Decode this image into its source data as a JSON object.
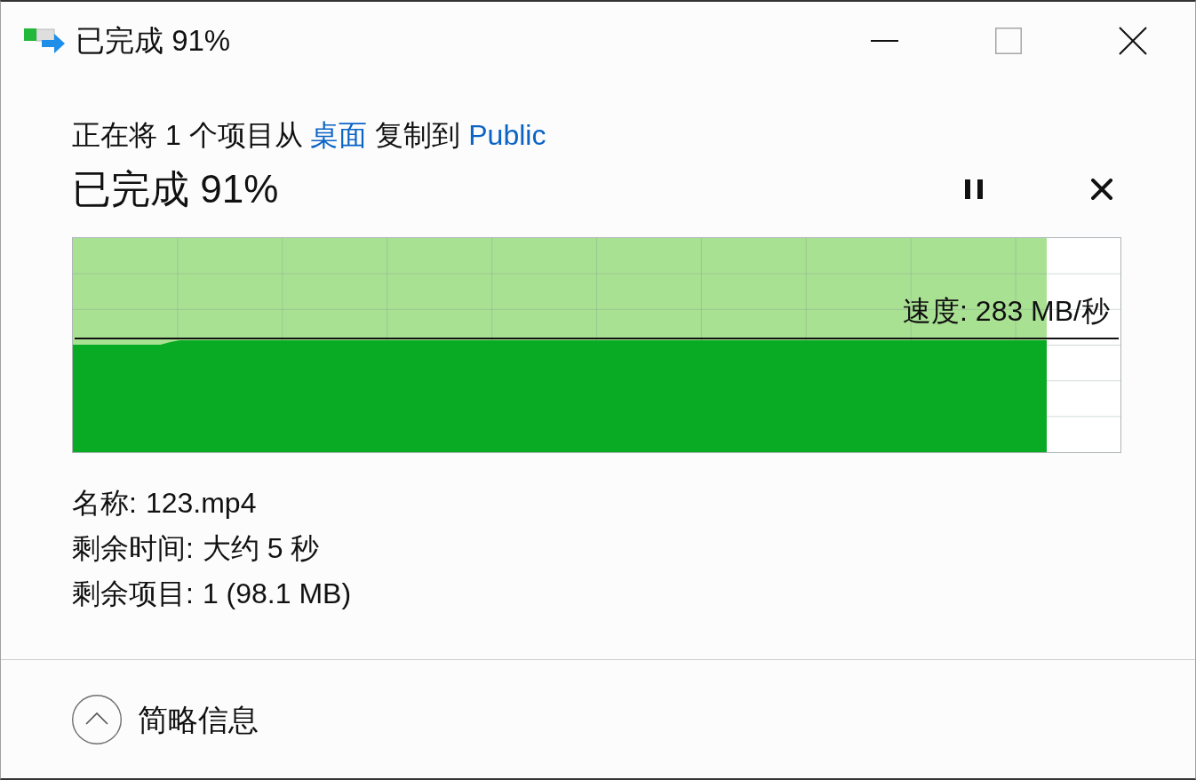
{
  "window": {
    "title": "已完成 91%",
    "controls": [
      {
        "kind": "minimize",
        "disabled": false
      },
      {
        "kind": "maximize",
        "disabled": true
      },
      {
        "kind": "close",
        "disabled": false
      }
    ]
  },
  "description": [
    {
      "kind": "text",
      "text": "正在将 1 个项目从 "
    },
    {
      "kind": "link",
      "text": "桌面"
    },
    {
      "kind": "text",
      "text": " 复制到 "
    },
    {
      "kind": "link",
      "text": "Public"
    }
  ],
  "progress": {
    "heading": "已完成 91%",
    "level": 0.93,
    "speed": "速度: 283 MB/秒"
  },
  "details": {
    "expanded": true,
    "rows": [
      {
        "label": "名称:",
        "value": "123.mp4"
      },
      {
        "label": "剩余时间:",
        "value": "大约 5 秒"
      },
      {
        "label": "剩余项目:",
        "value": "1 (98.1 MB)"
      }
    ],
    "toggle_label": "简略信息"
  }
}
